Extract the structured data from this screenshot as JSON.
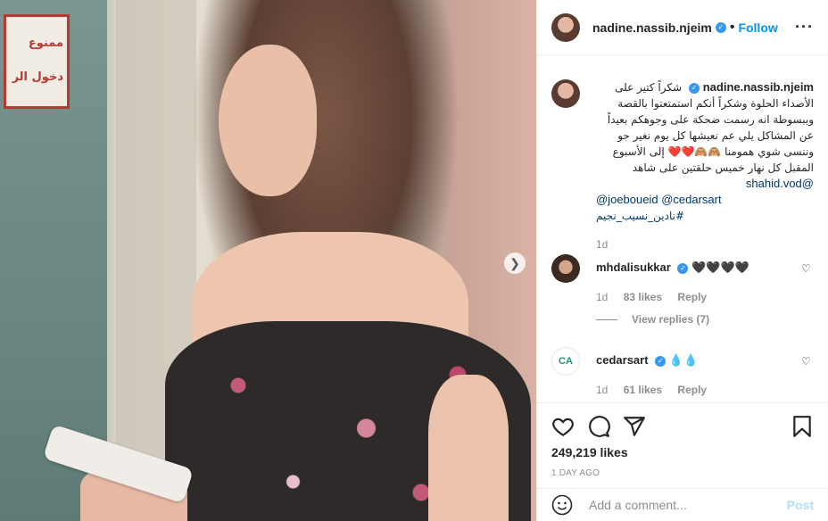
{
  "post": {
    "username": "nadine.nassib.njeim",
    "follow_label": "Follow",
    "more_icon": "more-options-icon",
    "sign_lines": [
      "ممنوع",
      "دخول الر"
    ]
  },
  "caption": {
    "username": "nadine.nassib.njeim",
    "text": "شكراً كتير على الأصداء الحلوة وشكراً أنكم استمتعتوا بالقصة وببسوطة انه رسمت ضحكة على وجوهكم بعيداً عن المشاكل يلي عم نعيشها كل يوم نغير جو وننسى شوي همومنا 🙈🙈❤️❤️ إلى الأسبوع المقبل كل نهار خميس حلقتين على شاهد",
    "mention1": "@shahid.vod",
    "mention2": "@joeboueid",
    "mention3": "@cedarsart",
    "hashtag": "#نادين_نسيب_نجيم",
    "time": "1d"
  },
  "comments": [
    {
      "username": "mhdalisukkar",
      "text": "🖤🖤🖤🖤",
      "time": "1d",
      "likes": "83 likes",
      "reply": "Reply"
    },
    {
      "username": "cedarsart",
      "text": "💧💧",
      "time": "1d",
      "likes": "61 likes",
      "reply": "Reply",
      "logo": "CA"
    }
  ],
  "view_replies": "View replies (7)",
  "likes": "249,219 likes",
  "posted": "1 DAY AGO",
  "add_comment": {
    "placeholder": "Add a comment...",
    "post_label": "Post"
  }
}
